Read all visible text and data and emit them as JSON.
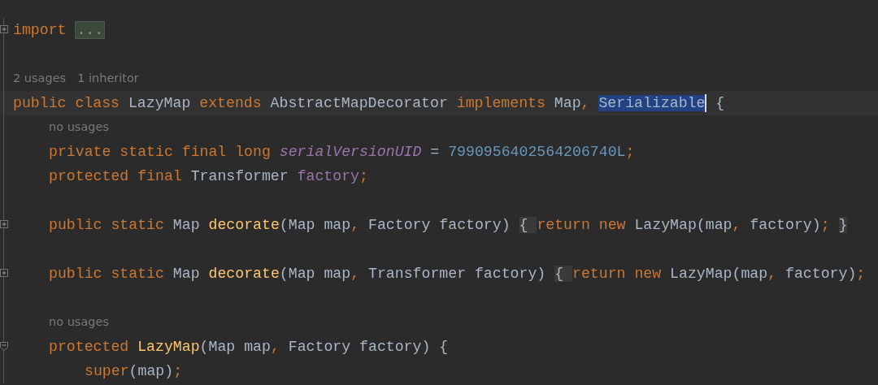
{
  "lines": [
    {
      "kind": "code",
      "fold": {
        "expanded": false
      },
      "tokens": [
        {
          "kind": "kw",
          "t": "import "
        },
        {
          "kind": "folded",
          "t": "..."
        }
      ]
    },
    {
      "kind": "blank"
    },
    {
      "kind": "hint",
      "hints": [
        "2 usages",
        "1 inheritor"
      ]
    },
    {
      "kind": "code",
      "current": true,
      "tokens": [
        {
          "kind": "kw",
          "t": "public class "
        },
        {
          "kind": "plain",
          "t": "LazyMap "
        },
        {
          "kind": "kw",
          "t": "extends "
        },
        {
          "kind": "plain",
          "t": "AbstractMapDecorator "
        },
        {
          "kind": "kw",
          "t": "implements "
        },
        {
          "kind": "plain",
          "t": "Map"
        },
        {
          "kind": "kw",
          "t": ", "
        },
        {
          "kind": "sel",
          "t": "Serializable",
          "caret": true
        },
        {
          "kind": "plain",
          "t": " {"
        }
      ],
      "children": [
        {
          "kind": "hint",
          "hints": [
            "no usages"
          ]
        },
        {
          "kind": "code",
          "tokens": [
            {
              "kind": "kw",
              "t": "private static final long "
            },
            {
              "kind": "sfield",
              "t": "serialVersionUID"
            },
            {
              "kind": "plain",
              "t": " = "
            },
            {
              "kind": "num",
              "t": "7990956402564206740L"
            },
            {
              "kind": "kw",
              "t": ";"
            }
          ]
        },
        {
          "kind": "code",
          "tokens": [
            {
              "kind": "kw",
              "t": "protected final "
            },
            {
              "kind": "plain",
              "t": "Transformer "
            },
            {
              "kind": "field",
              "t": "factory"
            },
            {
              "kind": "kw",
              "t": ";"
            }
          ]
        },
        {
          "kind": "blank"
        },
        {
          "kind": "code",
          "fold": {
            "expanded": false
          },
          "tokens": [
            {
              "kind": "kw",
              "t": "public static "
            },
            {
              "kind": "plain",
              "t": "Map "
            },
            {
              "kind": "fn",
              "t": "decorate"
            },
            {
              "kind": "plain",
              "t": "(Map map"
            },
            {
              "kind": "kw",
              "t": ", "
            },
            {
              "kind": "plain",
              "t": "Factory factory) "
            },
            {
              "kind": "brace",
              "t": "{ "
            },
            {
              "kind": "kw",
              "t": "return new "
            },
            {
              "kind": "plain",
              "t": "LazyMap(map"
            },
            {
              "kind": "kw",
              "t": ", "
            },
            {
              "kind": "plain",
              "t": "factory)"
            },
            {
              "kind": "kw",
              "t": "; "
            },
            {
              "kind": "brace",
              "t": "}"
            }
          ]
        },
        {
          "kind": "blank"
        },
        {
          "kind": "code",
          "fold": {
            "expanded": false
          },
          "tokens": [
            {
              "kind": "kw",
              "t": "public static "
            },
            {
              "kind": "plain",
              "t": "Map "
            },
            {
              "kind": "fn",
              "t": "decorate"
            },
            {
              "kind": "plain",
              "t": "(Map map"
            },
            {
              "kind": "kw",
              "t": ", "
            },
            {
              "kind": "plain",
              "t": "Transformer factory) "
            },
            {
              "kind": "brace",
              "t": "{ "
            },
            {
              "kind": "kw",
              "t": "return new "
            },
            {
              "kind": "plain",
              "t": "LazyMap(map"
            },
            {
              "kind": "kw",
              "t": ", "
            },
            {
              "kind": "plain",
              "t": "factory)"
            },
            {
              "kind": "kw",
              "t": ";"
            }
          ]
        },
        {
          "kind": "blank"
        },
        {
          "kind": "hint",
          "hints": [
            "no usages"
          ]
        },
        {
          "kind": "code",
          "fold": {
            "expanded": true
          },
          "tokens": [
            {
              "kind": "kw",
              "t": "protected "
            },
            {
              "kind": "fn",
              "t": "LazyMap"
            },
            {
              "kind": "plain",
              "t": "(Map map"
            },
            {
              "kind": "kw",
              "t": ", "
            },
            {
              "kind": "plain",
              "t": "Factory factory) {"
            }
          ],
          "children": [
            {
              "kind": "code",
              "tokens": [
                {
                  "kind": "kw",
                  "t": "super"
                },
                {
                  "kind": "plain",
                  "t": "(map)"
                },
                {
                  "kind": "kw",
                  "t": ";"
                }
              ]
            }
          ]
        }
      ]
    }
  ]
}
